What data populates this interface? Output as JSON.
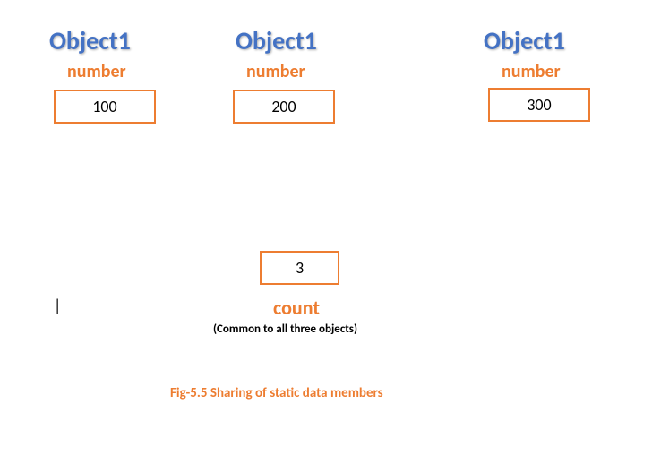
{
  "objects": [
    {
      "title": "Object1",
      "fieldLabel": "number",
      "value": "100"
    },
    {
      "title": "Object1",
      "fieldLabel": "number",
      "value": "200"
    },
    {
      "title": "Object1",
      "fieldLabel": "number",
      "value": "300"
    }
  ],
  "shared": {
    "value": "3",
    "label": "count",
    "note": "(Common to all three objects)"
  },
  "caption": "Fig-5.5    Sharing of static data members",
  "cursor": "|"
}
